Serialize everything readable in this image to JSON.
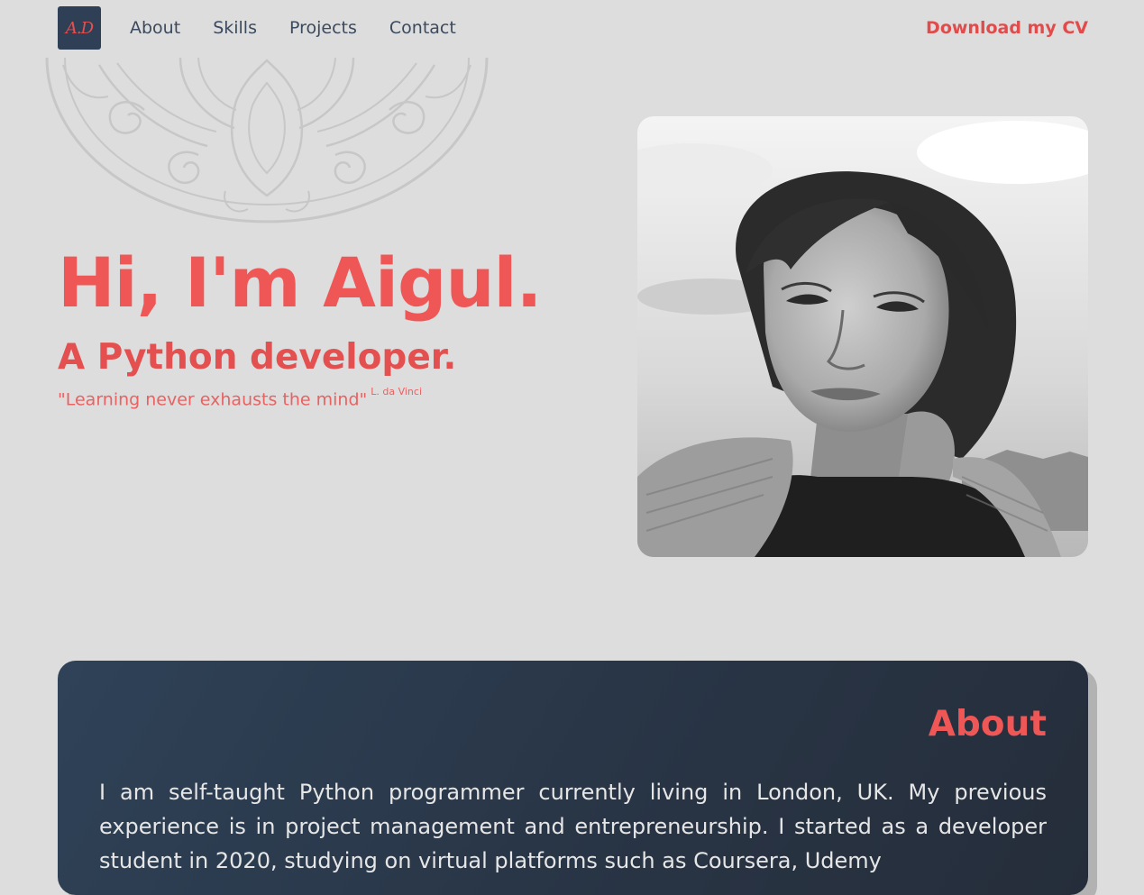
{
  "nav": {
    "logo_text": "A.D",
    "links": [
      "About",
      "Skills",
      "Projects",
      "Contact"
    ],
    "cv_label": "Download my CV"
  },
  "hero": {
    "name": "Hi, I'm Aigul.",
    "role": "A Python developer.",
    "quote": "\"Learning never exhausts the mind\"",
    "quote_author": "L. da Vinci"
  },
  "about": {
    "title": "About",
    "text": "I am self-taught Python programmer currently living in London, UK. My previous experience is in project management and entrepreneurship. I started as a developer student in 2020, studying on virtual platforms such as Coursera, Udemy"
  },
  "colors": {
    "background": "#dddddd",
    "accent": "#ef5757",
    "nav_text": "#3b4a5e",
    "card": "#2b3a4d"
  },
  "icons": {
    "ornament": "decorative-ornament",
    "portrait": "profile-photo"
  }
}
